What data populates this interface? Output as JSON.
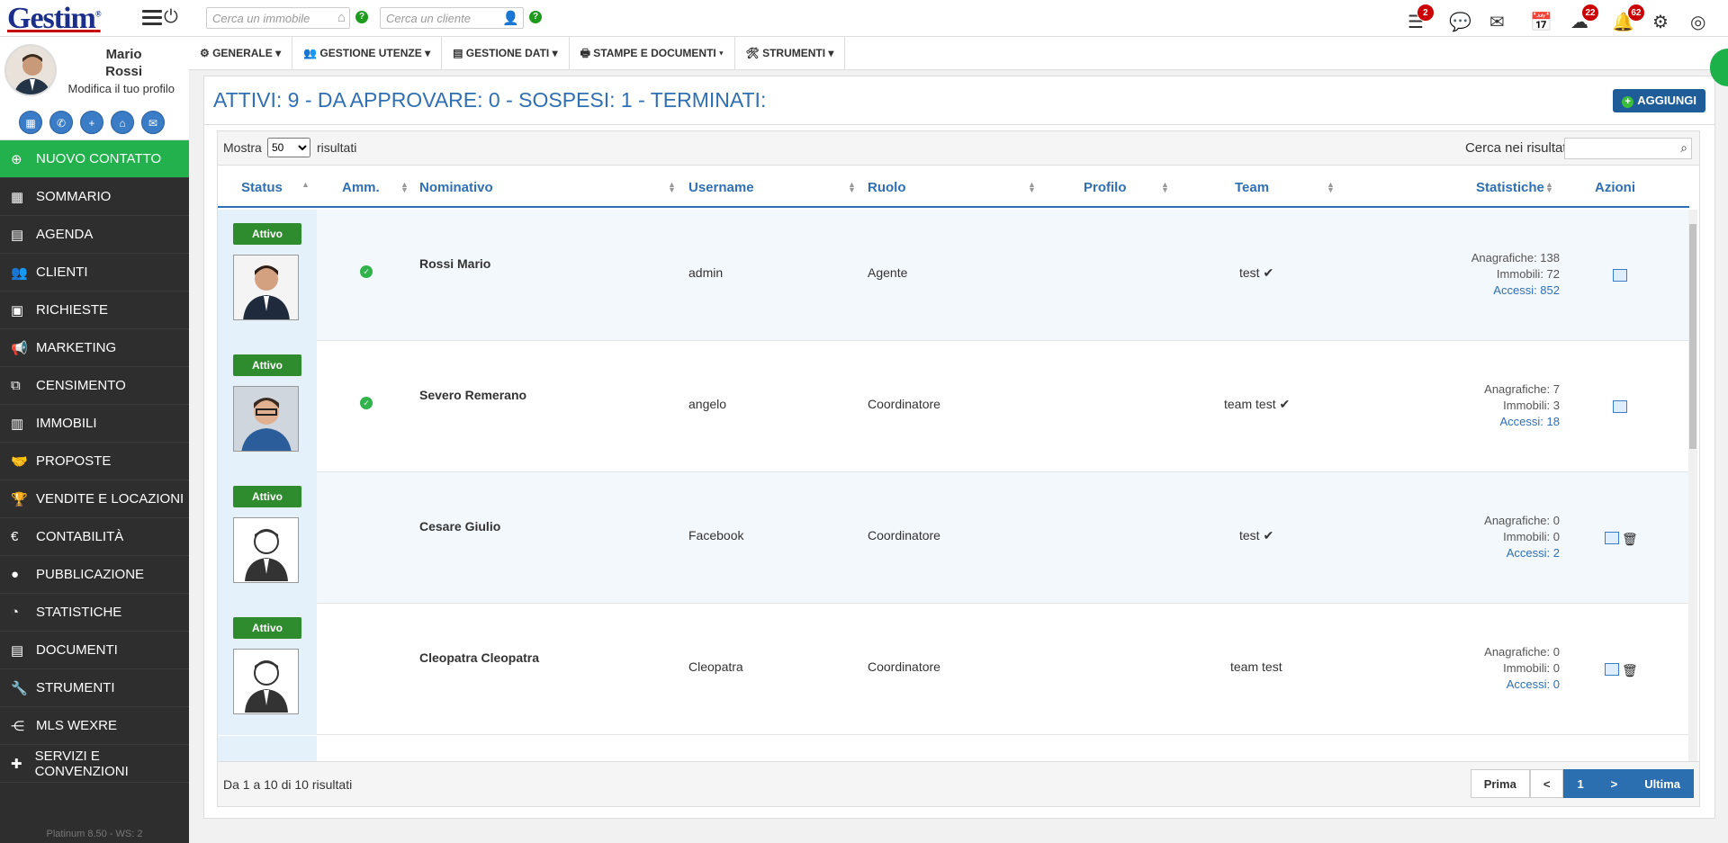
{
  "app": {
    "logo": "Gestim",
    "logo_mark": "®"
  },
  "topbar": {
    "search_property_placeholder": "Cerca un immobile",
    "search_client_placeholder": "Cerca un cliente",
    "badges": {
      "tasks": "2",
      "cloud": "22",
      "bell": "62"
    }
  },
  "profile": {
    "first_name": "Mario",
    "last_name": "Rossi",
    "edit_link": "Modifica il tuo profilo"
  },
  "sidebar": {
    "new_contact": "NUOVO CONTATTO",
    "items": [
      "SOMMARIO",
      "AGENDA",
      "CLIENTI",
      "RICHIESTE",
      "MARKETING",
      "CENSIMENTO",
      "IMMOBILI",
      "PROPOSTE",
      "VENDITE E LOCAZIONI",
      "CONTABILITÀ",
      "PUBBLICAZIONE",
      "STATISTICHE",
      "DOCUMENTI",
      "STRUMENTI",
      "MLS WEXRE",
      "SERVIZI E CONVENZIONI"
    ],
    "version": "Platinum 8.50 - WS: 2"
  },
  "navbar": [
    "GENERALE",
    "GESTIONE UTENZE",
    "GESTIONE DATI",
    "STAMPE E DOCUMENTI",
    "STRUMENTI"
  ],
  "page": {
    "title": "ATTIVI: 9 - DA APPROVARE: 0 - SOSPESI: 1 - TERMINATI:",
    "add_button": "AGGIUNGI"
  },
  "table": {
    "show_label": "Mostra",
    "show_value": "50",
    "results_label": "risultati",
    "search_label": "Cerca nei risultati:",
    "columns": [
      "Status",
      "Amm.",
      "Nominativo",
      "Username",
      "Ruolo",
      "Profilo",
      "Team",
      "Statistiche",
      "Azioni"
    ],
    "rows": [
      {
        "status": "Attivo",
        "name": "Rossi Mario",
        "username": "admin",
        "role": "Agente",
        "team": "test ✔",
        "s1": "Anagrafiche: 138",
        "s2": "Immobili: 72",
        "s3": "Accessi: 852"
      },
      {
        "status": "Attivo",
        "name": "Severo Remerano",
        "username": "angelo",
        "role": "Coordinatore",
        "team": "team test ✔",
        "s1": "Anagrafiche: 7",
        "s2": "Immobili: 3",
        "s3": "Accessi: 18"
      },
      {
        "status": "Attivo",
        "name": "Cesare Giulio",
        "username": "Facebook",
        "role": "Coordinatore",
        "team": "test ✔",
        "s1": "Anagrafiche: 0",
        "s2": "Immobili: 0",
        "s3": "Accessi: 2"
      },
      {
        "status": "Attivo",
        "name": "Cleopatra Cleopatra",
        "username": "Cleopatra",
        "role": "Coordinatore",
        "team": "team test",
        "s1": "Anagrafiche: 0",
        "s2": "Immobili: 0",
        "s3": "Accessi: 0"
      }
    ],
    "info": "Da 1 a 10 di 10 risultati",
    "pager": [
      "Prima",
      "<",
      "1",
      ">",
      "Ultima"
    ]
  }
}
